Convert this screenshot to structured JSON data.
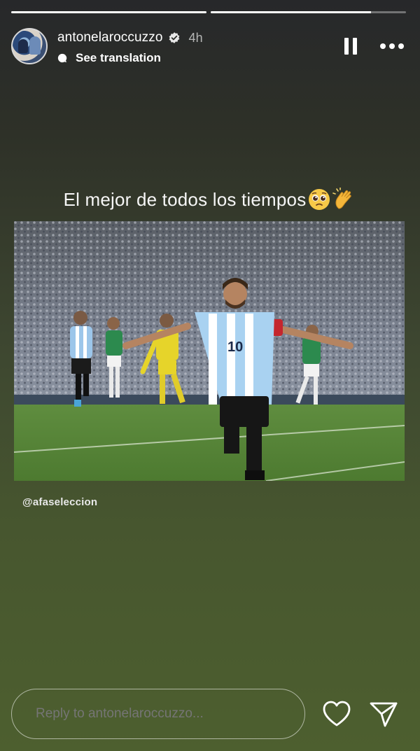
{
  "story": {
    "progress": [
      1.0,
      0.82
    ],
    "username": "antonelaroccuzzo",
    "verified": true,
    "time_ago": "4h",
    "translation_label": "See translation"
  },
  "icons": {
    "verified": "verified-badge-icon",
    "translation": "speech-bubble-icon",
    "pause": "pause-icon",
    "more": "more-dots-icon",
    "caption_emoji_1": "pleading-face-emoji",
    "caption_emoji_2": "clapping-hands-emoji",
    "like": "heart-icon",
    "send": "paper-plane-icon"
  },
  "content": {
    "caption_text": "El mejor de todos los tiempos",
    "photo_jersey_number": "10",
    "photo_credit": "@afaseleccion"
  },
  "reply": {
    "placeholder": "Reply to antonelaroccuzzo..."
  },
  "colors": {
    "accent_white": "#ffffff",
    "background_top": "#27282a",
    "background_bottom": "#4d5f2f",
    "verified_blue": "#3897f0"
  }
}
